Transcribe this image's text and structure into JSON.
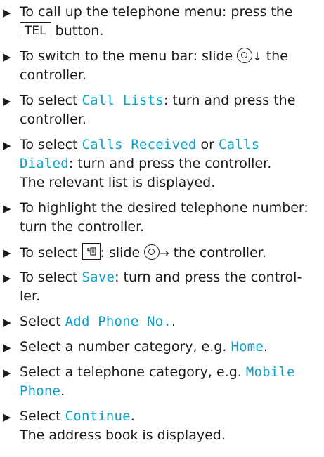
{
  "instructions": {
    "arrow_glyph": "▶",
    "steps": [
      {
        "lines": [
          "To call up the telephone menu: press the",
          "button."
        ],
        "key": "TEL"
      },
      {
        "lines": [
          "To switch to the menu bar: slide",
          "the",
          "controller."
        ],
        "controller_direction": "↓"
      },
      {
        "lines": [
          "To select",
          ": turn and press the",
          "controller."
        ],
        "ui": "Call Lists"
      },
      {
        "lines": [
          "To select",
          "or",
          ": turn and press the controller.",
          "The relevant list is displayed."
        ],
        "ui_1": "Calls Received",
        "ui_2a": "Calls",
        "ui_2b": "Dialed"
      },
      {
        "lines": [
          "To highlight the desired telephone number:",
          "turn the controller."
        ]
      },
      {
        "lines": [
          "To select",
          ": slide",
          "the controller."
        ],
        "icon_name": "phonebook-save-icon",
        "controller_direction": "→"
      },
      {
        "lines": [
          "To select",
          ": turn and press the control-",
          "ler."
        ],
        "ui": "Save"
      },
      {
        "lines": [
          "Select",
          "."
        ],
        "ui": "Add Phone No."
      },
      {
        "lines": [
          "Select a number category, e.g.",
          "."
        ],
        "ui": "Home"
      },
      {
        "lines": [
          "Select a telephone category, e.g.",
          "."
        ],
        "ui_a": "Mobile",
        "ui_b": "Phone"
      },
      {
        "lines": [
          "Select",
          ".",
          "The address book is displayed."
        ],
        "ui": "Continue"
      }
    ]
  }
}
